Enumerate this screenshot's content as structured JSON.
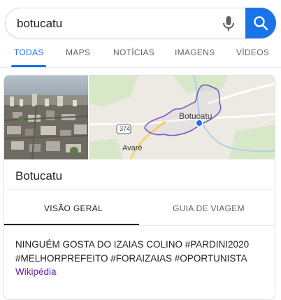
{
  "search": {
    "query": "botucatu"
  },
  "tabs": [
    {
      "label": "TODAS",
      "active": true
    },
    {
      "label": "MAPS",
      "active": false
    },
    {
      "label": "NOTÍCIAS",
      "active": false
    },
    {
      "label": "IMAGENS",
      "active": false
    },
    {
      "label": "VÍDEOS",
      "active": false
    }
  ],
  "knowledge_panel": {
    "title": "Botucatu",
    "map": {
      "city_label": "Botucatu",
      "road_label": "374",
      "nearby_label": "Avaré"
    },
    "subtabs": [
      {
        "label": "VISÃO GERAL",
        "active": true
      },
      {
        "label": "GUIA DE VIAGEM",
        "active": false
      }
    ],
    "description": "NINGUÉM GOSTA DO IZAIAS COLINO #PARDINI2020 #MELHORPREFEITO #FORAIZAIAS #OPORTUNISTA",
    "source_link": "Wikipédia"
  },
  "colors": {
    "accent": "#1a73e8",
    "link_visited": "#681da8",
    "map_boundary": "#7e57c2",
    "map_pin": "#1a73e8"
  }
}
